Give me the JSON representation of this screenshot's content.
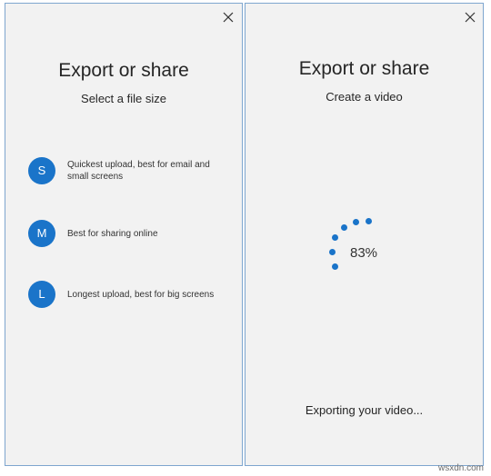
{
  "left_panel": {
    "title": "Export or share",
    "subtitle": "Select a file size",
    "options": [
      {
        "letter": "S",
        "description": "Quickest upload, best for email and small screens"
      },
      {
        "letter": "M",
        "description": "Best for sharing online"
      },
      {
        "letter": "L",
        "description": "Longest upload, best for big screens"
      }
    ]
  },
  "right_panel": {
    "title": "Export or share",
    "subtitle": "Create a video",
    "progress_label": "83%",
    "progress_value": 83,
    "status": "Exporting your video..."
  },
  "watermark": "wsxdn.com",
  "colors": {
    "accent": "#1a74c9",
    "panel_background": "#f2f2f2",
    "panel_border": "#7ea6cf"
  },
  "icons": {
    "close": "close-icon",
    "progress": "progress-ring-icon"
  }
}
